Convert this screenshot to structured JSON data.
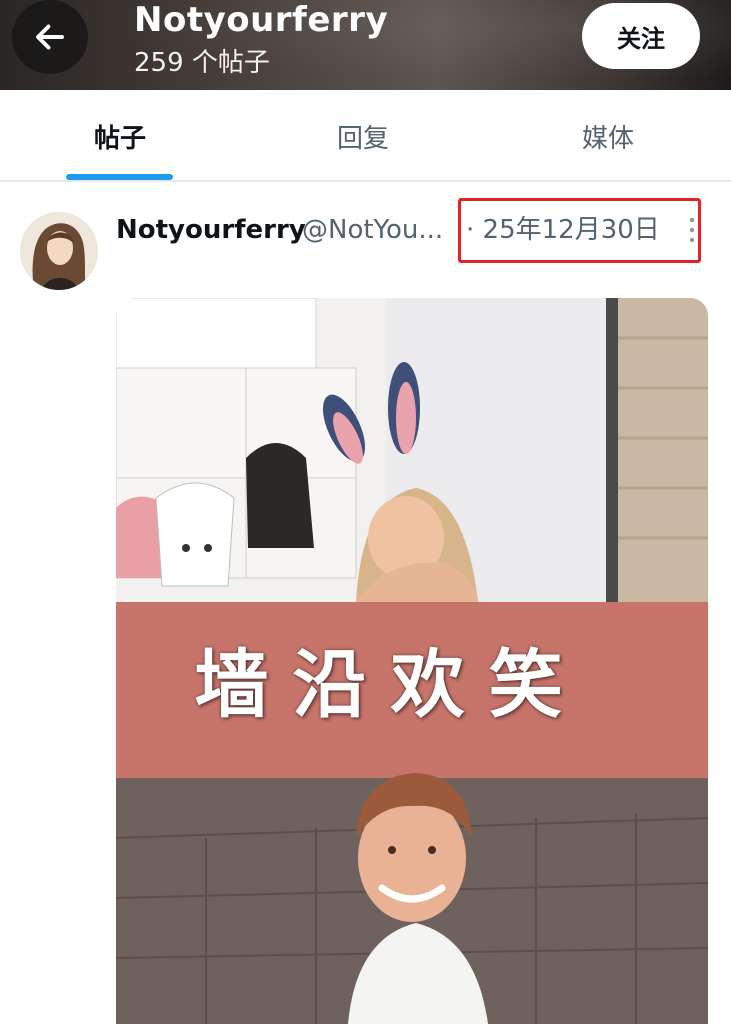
{
  "header": {
    "title": "Notyourferry",
    "post_count": "259 个帖子",
    "follow_label": "关注"
  },
  "tabs": [
    {
      "label": "帖子",
      "active": true
    },
    {
      "label": "回复",
      "active": false
    },
    {
      "label": "媒体",
      "active": false
    }
  ],
  "post": {
    "display_name": "Notyourferry",
    "handle": "@NotYou...",
    "date": "· 25年12月30日",
    "media": {
      "meme_caption": "墙沿欢笑"
    }
  },
  "colors": {
    "accent": "#1d9bf0",
    "highlight_box": "#e02424",
    "text_primary": "#0f1419",
    "text_secondary": "#536471"
  },
  "icons": {
    "back": "arrow-left-icon",
    "more": "more-vertical-icon"
  }
}
